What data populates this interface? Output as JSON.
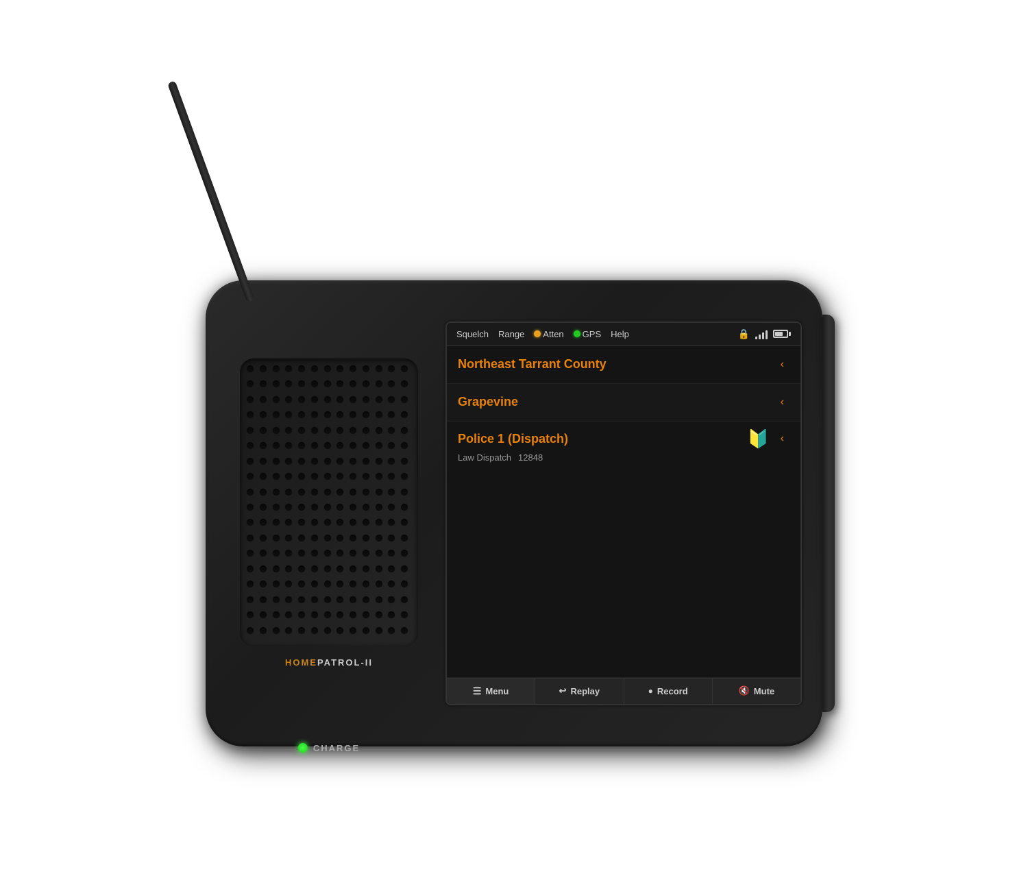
{
  "device": {
    "brand_home": "HOME",
    "brand_patrol": "PATROL-II",
    "charge_label": "CHARGE"
  },
  "screen": {
    "status_bar": {
      "squelch": "Squelch",
      "range": "Range",
      "atten_label": "Atten",
      "gps_label": "GPS",
      "help": "Help"
    },
    "rows": [
      {
        "main_text": "Northeast Tarrant County",
        "arrow": "<"
      },
      {
        "main_text": "Grapevine",
        "arrow": "<"
      },
      {
        "channel_name": "Police 1 (Dispatch)",
        "meta1": "Law Dispatch",
        "meta2": "12848",
        "has_badge": true,
        "arrow": "<"
      }
    ],
    "toolbar": {
      "menu": "Menu",
      "replay": "Replay",
      "record": "Record",
      "mute": "Mute"
    }
  }
}
